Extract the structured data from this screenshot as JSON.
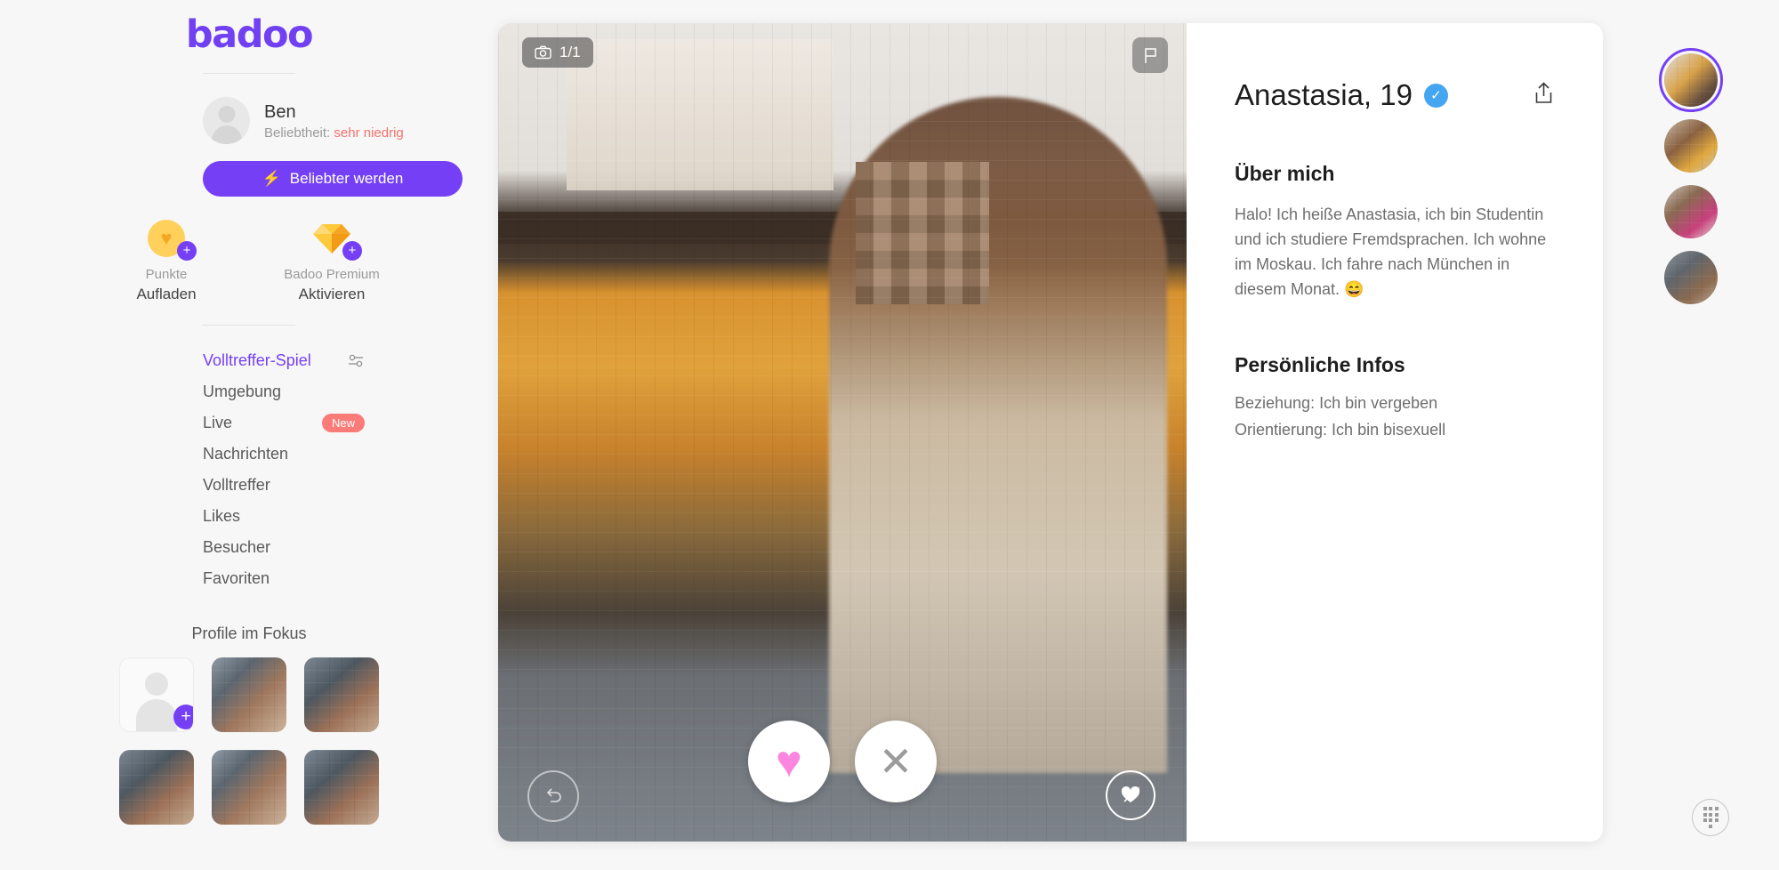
{
  "brand": {
    "name": "badoo",
    "accent": "#7540f5"
  },
  "user": {
    "name": "Ben",
    "popularity_label": "Beliebtheit:",
    "popularity_value": "sehr niedrig",
    "popularity_color": "#f4726f",
    "promo_button": "Beliebter werden"
  },
  "tiles": [
    {
      "caption": "Punkte",
      "action": "Aufladen",
      "icon": "coin-heart-icon"
    },
    {
      "caption": "Badoo Premium",
      "action": "Aktivieren",
      "icon": "gem-icon"
    }
  ],
  "nav": [
    {
      "label": "Volltreffer-Spiel",
      "active": true,
      "icon": "sliders-icon"
    },
    {
      "label": "Umgebung",
      "active": false
    },
    {
      "label": "Live",
      "active": false,
      "badge": "New"
    },
    {
      "label": "Nachrichten",
      "active": false
    },
    {
      "label": "Volltreffer",
      "active": false
    },
    {
      "label": "Likes",
      "active": false
    },
    {
      "label": "Besucher",
      "active": false
    },
    {
      "label": "Favoriten",
      "active": false
    }
  ],
  "focus": {
    "title": "Profile im Fokus"
  },
  "photo": {
    "counter": "1/1",
    "counter_icon": "camera-icon",
    "flag_icon": "flag-icon"
  },
  "actions": {
    "like": "heart-icon",
    "pass": "close-icon",
    "undo": "undo-icon",
    "crush": "heart-arrow-icon"
  },
  "profile": {
    "name_age": "Anastasia, 19",
    "verified_icon": "verified-check-icon",
    "share_icon": "share-icon",
    "about_title": "Über mich",
    "about_text": "Halo! Ich heiße Anastasia, ich bin Studentin und ich studiere Fremdsprachen. Ich wohne im Moskau. Ich fahre nach München in diesem Monat. 😄",
    "personal_title": "Persönliche Infos",
    "personal": [
      "Beziehung: Ich bin vergeben",
      "Orientierung: Ich bin bisexuell"
    ]
  },
  "rail": {
    "grid_icon": "grid-menu-icon"
  }
}
